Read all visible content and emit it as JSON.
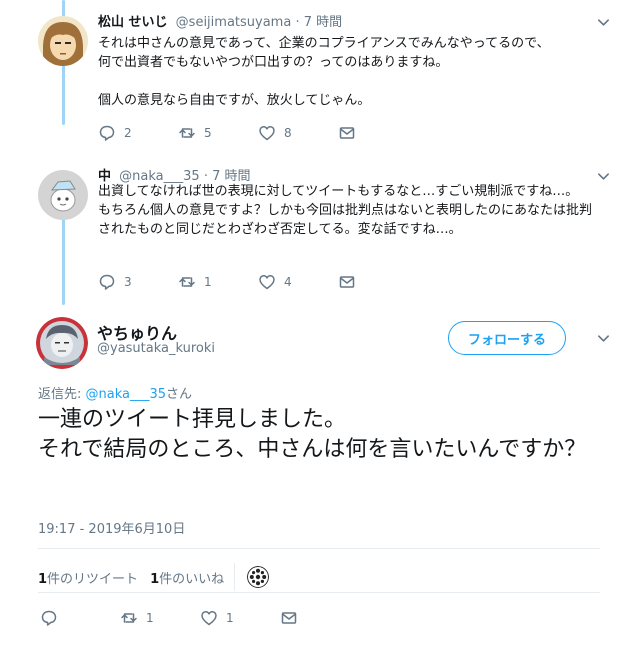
{
  "replies": [
    {
      "name": "松山 せいじ",
      "handle": "@seijimatsuyama",
      "time": "7 時間",
      "lines": [
        "それは中さんの意見であって、企業のコプライアンスでみんなやってるので、",
        "何で出資者でもないやつが口出すの？ってのはありますね。",
        "",
        "個人の意見なら自由ですが、放火してじゃん。"
      ],
      "replies_count": "2",
      "retweets_count": "5",
      "likes_count": "8"
    },
    {
      "name": "中",
      "handle": "@naka___35",
      "time": "7 時間",
      "lines": [
        "出資してなければ世の表現に対してツイートもするなと…すごい規制派ですね…。",
        "もちろん個人の意見ですよ？しかも今回は批判点はないと表明したのにあなたは批判されたものと同じだとわざわざ否定してる。変な話ですね…。"
      ],
      "replies_count": "3",
      "retweets_count": "1",
      "likes_count": "4"
    }
  ],
  "main_tweet": {
    "name": "やちゅりん",
    "handle": "@yasutaka_kuroki",
    "follow_label": "フォローする",
    "reply_to_prefix": "返信先: ",
    "reply_to_handle": "@naka___35",
    "reply_to_suffix": "さん",
    "lines": [
      "一連のツイート拝見しました。",
      "それで結局のところ、中さんは何を言いたいんですか？"
    ],
    "timestamp": "19:17 - 2019年6月10日",
    "retweet_stat_count": "1",
    "retweet_stat_label": "件のリツイート",
    "like_stat_count": "1",
    "like_stat_label": "件のいいね",
    "retweets_count": "1",
    "likes_count": "1"
  },
  "icons": {
    "reply": "reply-icon",
    "retweet": "retweet-icon",
    "like": "heart-icon",
    "message": "envelope-icon",
    "more": "chevron-down-icon"
  },
  "colors": {
    "link": "#1da1f2",
    "thread_line": "#9fd3f7",
    "secondary_text": "#657786",
    "primary_text": "#14171a",
    "divider": "#e6ecf0"
  }
}
